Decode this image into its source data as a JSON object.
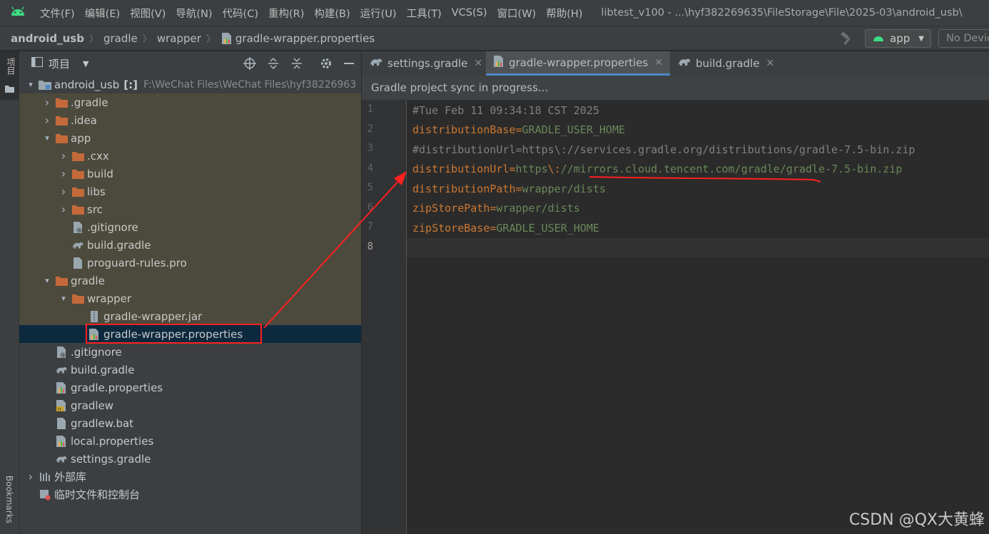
{
  "menubar": {
    "items": [
      "文件(F)",
      "编辑(E)",
      "视图(V)",
      "导航(N)",
      "代码(C)",
      "重构(R)",
      "构建(B)",
      "运行(U)",
      "工具(T)",
      "VCS(S)",
      "窗口(W)",
      "帮助(H)"
    ],
    "window_title": "libtest_v100 - ...\\hyf382269635\\FileStorage\\File\\2025-03\\android_usb\\"
  },
  "breadcrumb": [
    "android_usb",
    "gradle",
    "wrapper",
    "gradle-wrapper.properties"
  ],
  "toolbar": {
    "run_config": "app",
    "device": "No Devic"
  },
  "left_strip": {
    "project_label": "项目",
    "bookmarks_label": "Bookmarks"
  },
  "project_panel": {
    "title": "项目",
    "root": {
      "name": "android_usb",
      "module_tag": "[:]",
      "path": "F:\\WeChat Files\\WeChat Files\\hyf38226963"
    },
    "tree": [
      {
        "label": ".gradle",
        "depth": 1,
        "kind": "folder",
        "arrow": "collapsed"
      },
      {
        "label": ".idea",
        "depth": 1,
        "kind": "folder",
        "arrow": "collapsed"
      },
      {
        "label": "app",
        "depth": 1,
        "kind": "folder",
        "arrow": "expanded"
      },
      {
        "label": ".cxx",
        "depth": 2,
        "kind": "folder",
        "arrow": "collapsed"
      },
      {
        "label": "build",
        "depth": 2,
        "kind": "folder",
        "arrow": "collapsed"
      },
      {
        "label": "libs",
        "depth": 2,
        "kind": "folder",
        "arrow": "collapsed"
      },
      {
        "label": "src",
        "depth": 2,
        "kind": "folder",
        "arrow": "collapsed"
      },
      {
        "label": ".gitignore",
        "depth": 2,
        "kind": "gitignore",
        "arrow": "none"
      },
      {
        "label": "build.gradle",
        "depth": 2,
        "kind": "gradle",
        "arrow": "none"
      },
      {
        "label": "proguard-rules.pro",
        "depth": 2,
        "kind": "file",
        "arrow": "none"
      },
      {
        "label": "gradle",
        "depth": 1,
        "kind": "folder",
        "arrow": "expanded"
      },
      {
        "label": "wrapper",
        "depth": 2,
        "kind": "folder",
        "arrow": "expanded"
      },
      {
        "label": "gradle-wrapper.jar",
        "depth": 3,
        "kind": "jar",
        "arrow": "none"
      },
      {
        "label": "gradle-wrapper.properties",
        "depth": 3,
        "kind": "properties",
        "arrow": "none",
        "selected": true
      },
      {
        "label": ".gitignore",
        "depth": 1,
        "kind": "gitignore",
        "arrow": "none"
      },
      {
        "label": "build.gradle",
        "depth": 1,
        "kind": "gradle",
        "arrow": "none"
      },
      {
        "label": "gradle.properties",
        "depth": 1,
        "kind": "properties",
        "arrow": "none"
      },
      {
        "label": "gradlew",
        "depth": 1,
        "kind": "shell",
        "arrow": "none"
      },
      {
        "label": "gradlew.bat",
        "depth": 1,
        "kind": "file",
        "arrow": "none"
      },
      {
        "label": "local.properties",
        "depth": 1,
        "kind": "properties",
        "arrow": "none"
      },
      {
        "label": "settings.gradle",
        "depth": 1,
        "kind": "gradle",
        "arrow": "none"
      }
    ],
    "external_libs": "外部库",
    "scratches": "临时文件和控制台"
  },
  "editor": {
    "tabs": [
      {
        "label": "settings.gradle",
        "active": false
      },
      {
        "label": "gradle-wrapper.properties",
        "active": true
      },
      {
        "label": "build.gradle",
        "active": false
      }
    ],
    "sync_banner": "Gradle project sync in progress...",
    "line_numbers": [
      "1",
      "2",
      "3",
      "4",
      "5",
      "6",
      "7",
      "8"
    ],
    "lines": [
      {
        "comment": "#Tue Feb 11 09:34:18 CST 2025"
      },
      {
        "key": "distributionBase",
        "value": "GRADLE_USER_HOME"
      },
      {
        "comment": "#distributionUrl=https\\://services.gradle.org/distributions/gradle-7.5-bin.zip"
      },
      {
        "key": "distributionUrl",
        "value_a": "https",
        "esc": "\\:",
        "value_b": "//mirrors.cloud.tencent.com/gradle/gradle-7.5-bin.zip"
      },
      {
        "key": "distributionPath",
        "value": "wrapper/dists"
      },
      {
        "key": "zipStorePath",
        "value": "wrapper/dists"
      },
      {
        "key": "zipStoreBase",
        "value": "GRADLE_USER_HOME"
      },
      {
        "comment": ""
      }
    ],
    "current_line": 8
  },
  "watermark": "CSDN @QX大黄蜂",
  "colors": {
    "accent": "#4a88c7",
    "annotation_red": "#ff2020",
    "key_orange": "#cc7832",
    "value_green": "#6a8759",
    "folder_orange": "#c46a3a"
  }
}
